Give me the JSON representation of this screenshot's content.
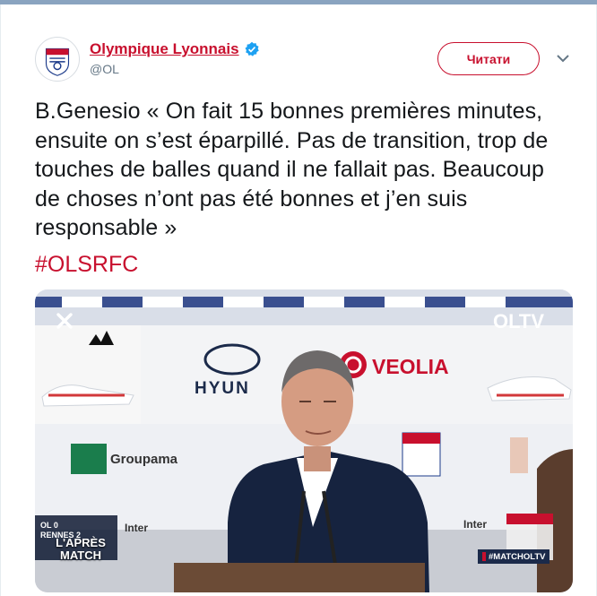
{
  "tweet": {
    "display_name": "Olympique Lyonnais",
    "handle": "@OL",
    "follow_label": "Читати",
    "text": "B.Genesio « On fait 15 bonnes premières minutes, ensuite on s’est éparpillé. Pas de transition, trop de touches de balles quand il ne fallait pas. Beaucoup de choses n’ont pas été bonnes et j’en suis responsable »",
    "hashtag": "#OLSRFC",
    "icons": {
      "verified": "verified-badge-icon",
      "caret": "chevron-down-icon",
      "close": "close-icon"
    }
  },
  "media": {
    "oltv": "OLTV",
    "sponsors": [
      "adidas",
      "HYUNDAI",
      "VEOLIA",
      "Groupama",
      "Intersport"
    ],
    "club_badge": "OLYMPIQUE LYONNAIS",
    "score_lines": [
      "OL 0",
      "RENNES 2"
    ],
    "show_title": "L'APRÈS MATCH",
    "hashtag_tag": "#MATCHOLTV"
  },
  "colors": {
    "brand_red": "#c8102e",
    "text": "#14171a",
    "muted": "#657786",
    "ol_blue": "#1b3a8a"
  }
}
